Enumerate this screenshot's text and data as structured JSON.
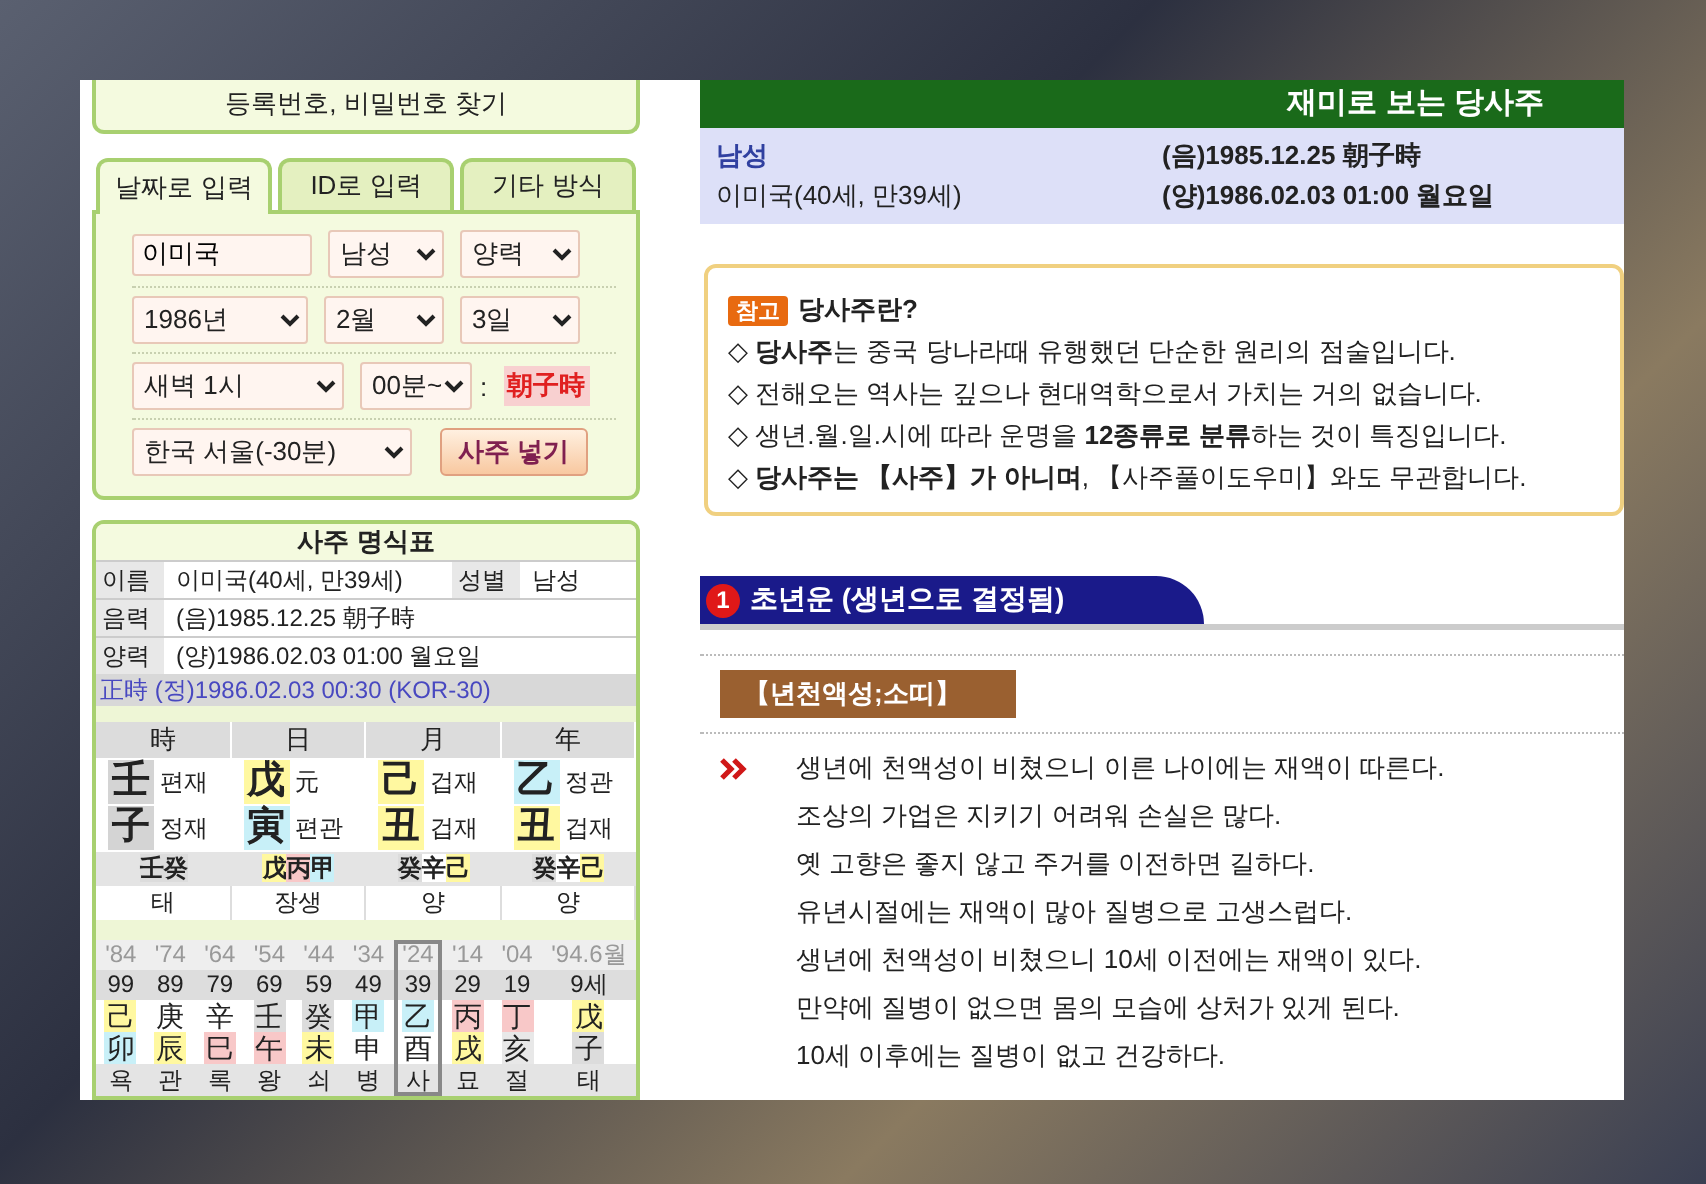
{
  "find_link": "등록번호, 비밀번호 찾기",
  "tabs": [
    {
      "label": "날짜로 입력",
      "selected": true
    },
    {
      "label": "ID로 입력",
      "selected": false
    },
    {
      "label": "기타 방식",
      "selected": false
    }
  ],
  "form": {
    "name": {
      "value": "이미국"
    },
    "gender": "남성",
    "calendar": "양력",
    "year": "1986년",
    "month": "2월",
    "day": "3일",
    "hour": "새벽 1시",
    "minute": "00분~",
    "separator": ":",
    "hour_name": "朝子時",
    "location": "한국 서울(-30분)",
    "submit": "사주 넣기"
  },
  "chart": {
    "title": "사주 명식표",
    "name_label": "이름",
    "name": "이미국(40세, 만39세)",
    "gender_label": "성별",
    "gender": "남성",
    "lunar_label": "음력",
    "lunar": "(음)1985.12.25 朝子時",
    "solar_label": "양력",
    "solar": "(양)1986.02.03 01:00 월요일",
    "true_time": "正時 (정)1986.02.03 00:30 (KOR-30)",
    "pillars": [
      {
        "header": "時",
        "stem": {
          "char": "壬",
          "color": "#d4d4d4"
        },
        "stem_god": "편재",
        "branch": {
          "char": "子",
          "color": "#d4d4d4"
        },
        "branch_god": "정재",
        "hidden": [
          {
            "char": "壬",
            "color": "#dcdcdc"
          },
          {
            "char": "癸",
            "color": "#dcdcdc"
          }
        ],
        "stage": "태"
      },
      {
        "header": "日",
        "stem": {
          "char": "戊",
          "color": "#fff8a0"
        },
        "stem_god": "元",
        "branch": {
          "char": "寅",
          "color": "#c8f0f8"
        },
        "branch_god": "편관",
        "hidden": [
          {
            "char": "戊",
            "color": "#fff8a0"
          },
          {
            "char": "丙",
            "color": "#f8c8c8"
          },
          {
            "char": "甲",
            "color": "#c8f0f8"
          }
        ],
        "stage": "장생"
      },
      {
        "header": "月",
        "stem": {
          "char": "己",
          "color": "#fff8a0"
        },
        "stem_god": "겁재",
        "branch": {
          "char": "丑",
          "color": "#fff8a0"
        },
        "branch_god": "겁재",
        "hidden": [
          {
            "char": "癸",
            "color": "#dcdcdc"
          },
          {
            "char": "辛",
            "color": "#ffffff"
          },
          {
            "char": "己",
            "color": "#fff8a0"
          }
        ],
        "stage": "양"
      },
      {
        "header": "年",
        "stem": {
          "char": "乙",
          "color": "#c8f0f8"
        },
        "stem_god": "정관",
        "branch": {
          "char": "丑",
          "color": "#fff8a0"
        },
        "branch_god": "겁재",
        "hidden": [
          {
            "char": "癸",
            "color": "#dcdcdc"
          },
          {
            "char": "辛",
            "color": "#ffffff"
          },
          {
            "char": "己",
            "color": "#fff8a0"
          }
        ],
        "stage": "양"
      }
    ],
    "luck": [
      {
        "year": "'84",
        "age": "99",
        "stem": {
          "char": "己",
          "color": "#fff8a0"
        },
        "branch": {
          "char": "卯",
          "color": "#c8f0f8"
        },
        "stage": "욕",
        "selected": false
      },
      {
        "year": "'74",
        "age": "89",
        "stem": {
          "char": "庚",
          "color": "#ffffff"
        },
        "branch": {
          "char": "辰",
          "color": "#fff8a0"
        },
        "stage": "관",
        "selected": false
      },
      {
        "year": "'64",
        "age": "79",
        "stem": {
          "char": "辛",
          "color": "#ffffff"
        },
        "branch": {
          "char": "巳",
          "color": "#f8c8c8"
        },
        "stage": "록",
        "selected": false
      },
      {
        "year": "'54",
        "age": "69",
        "stem": {
          "char": "壬",
          "color": "#dcdcdc"
        },
        "branch": {
          "char": "午",
          "color": "#f8c8c8"
        },
        "stage": "왕",
        "selected": false
      },
      {
        "year": "'44",
        "age": "59",
        "stem": {
          "char": "癸",
          "color": "#dcdcdc"
        },
        "branch": {
          "char": "未",
          "color": "#fff8a0"
        },
        "stage": "쇠",
        "selected": false
      },
      {
        "year": "'34",
        "age": "49",
        "stem": {
          "char": "甲",
          "color": "#c8f0f8"
        },
        "branch": {
          "char": "申",
          "color": "#ffffff"
        },
        "stage": "병",
        "selected": false
      },
      {
        "year": "'24",
        "age": "39",
        "stem": {
          "char": "乙",
          "color": "#c8f0f8"
        },
        "branch": {
          "char": "酉",
          "color": "#ffffff"
        },
        "stage": "사",
        "selected": true
      },
      {
        "year": "'14",
        "age": "29",
        "stem": {
          "char": "丙",
          "color": "#f8c8c8"
        },
        "branch": {
          "char": "戌",
          "color": "#fff8a0"
        },
        "stage": "묘",
        "selected": false
      },
      {
        "year": "'04",
        "age": "19",
        "stem": {
          "char": "丁",
          "color": "#f8c8c8"
        },
        "branch": {
          "char": "亥",
          "color": "#e8e8e8"
        },
        "stage": "절",
        "selected": false
      },
      {
        "year": "'94.6월",
        "age": "9세",
        "stem": {
          "char": "戊",
          "color": "#fff8a0"
        },
        "branch": {
          "char": "子",
          "color": "#dcdcdc"
        },
        "stage": "태",
        "selected": false
      }
    ]
  },
  "result": {
    "title": "재미로 보는 당사주",
    "gender": "남성",
    "name": "이미국(40세, 만39세)",
    "lunar": "(음)1985.12.25 朝子時",
    "solar": "(양)1986.02.03 01:00 월요일"
  },
  "notice": {
    "badge": "참고",
    "title": "당사주란?",
    "lines": [
      "◇ **당사주**는 중국 당나라때 유행했던 단순한 원리의 점술입니다.",
      "◇ 전해오는 역사는 깊으나 현대역학으로서 가치는 거의 없습니다.",
      "◇ 생년.월.일.시에 따라 운명을 **12종류로 분류**하는 것이 특징입니다.",
      "◇ **당사주는 【사주】가 아니며**, 【사주풀이도우미】와도 무관합니다."
    ]
  },
  "section": {
    "number": "1",
    "title": "초년운 (생년으로 결정됨)",
    "label": "【년천액성;소띠】",
    "lines": [
      {
        "text": "생년에 천액성이 비쳤으니 이른 나이에는 재액이 따른다.",
        "marked": true
      },
      {
        "text": "조상의 가업은 지키기 어려워 손실은 많다.",
        "marked": false
      },
      {
        "text": "옛 고향은 좋지 않고 주거를 이전하면 길하다.",
        "marked": false
      },
      {
        "text": "유년시절에는 재액이 많아 질병으로 고생스럽다.",
        "marked": false
      },
      {
        "text": "생년에 천액성이 비쳤으니 10세 이전에는 재액이 있다.",
        "marked": false
      },
      {
        "text": "만약에 질병이 없으면 몸의 모습에 상처가 있게 된다.",
        "marked": false
      },
      {
        "text": "10세 이후에는 질병이 없고 건강하다.",
        "marked": false
      }
    ]
  }
}
